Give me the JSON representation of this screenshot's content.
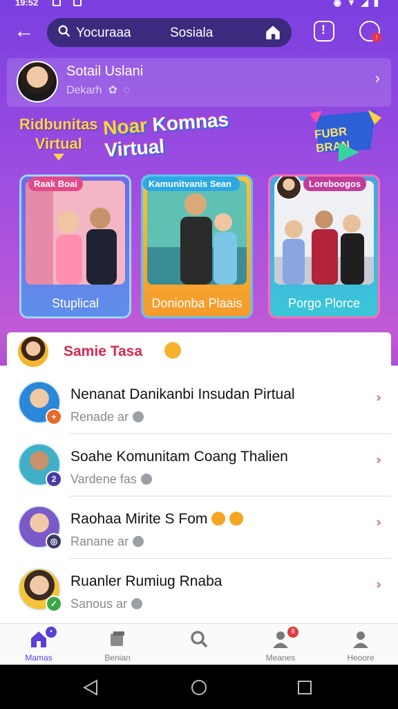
{
  "status_bar": {
    "time": "19:52"
  },
  "top_bar": {
    "search_left": "Yocuraaa",
    "search_right": "Sosiala"
  },
  "profile": {
    "name": "Sotail Uslani",
    "subtitle": "Dekarh"
  },
  "banner": {
    "left_title_line1": "Ridbunitas",
    "left_title_line2": "Virtual",
    "main_title_a": "Noar",
    "main_title_b": "Komnas Virtual",
    "badge_text": "FUBR BRAN",
    "cards": [
      {
        "tag": "Raak Boai",
        "label": "Stuplical"
      },
      {
        "tag": "Kamunitvanis Sean",
        "label": "Donionba Plaais"
      },
      {
        "tag": "Loreboogos",
        "label": "Porgo Plorce"
      }
    ]
  },
  "panel": {
    "header_title": "Samie Tasa",
    "items": [
      {
        "title": "Nenanat Danikanbi Insudan Pirtual",
        "sub": "Renade ar",
        "badge_color": "#e86a2a",
        "avatar_color": "#2b88d8"
      },
      {
        "title": "Soahe Komunitam Coang Thalien",
        "sub": "Vardene fas",
        "badge_color": "#4a3aa8",
        "avatar_color": "#3fb0c8"
      },
      {
        "title": "Raohaa Mirite S Fom",
        "sub": "Ranane ar",
        "badge_color": "#3a3a6a",
        "avatar_color": "#7a5ac8"
      },
      {
        "title": "Ruanler Rumiug Rnaba",
        "sub": "Sanous ar",
        "badge_color": "#3aa84a",
        "avatar_color": "#f6c33b"
      }
    ]
  },
  "bottom_nav": {
    "items": [
      {
        "label": "Mamas",
        "badge": ""
      },
      {
        "label": "Benian",
        "badge": ""
      },
      {
        "label": "",
        "badge": ""
      },
      {
        "label": "Meanes",
        "badge": "8"
      },
      {
        "label": "Heoore",
        "badge": ""
      }
    ]
  },
  "colors": {
    "accent": "#5b3fd6",
    "header_purple": "#7b3fe0",
    "title_red": "#d6294f"
  }
}
